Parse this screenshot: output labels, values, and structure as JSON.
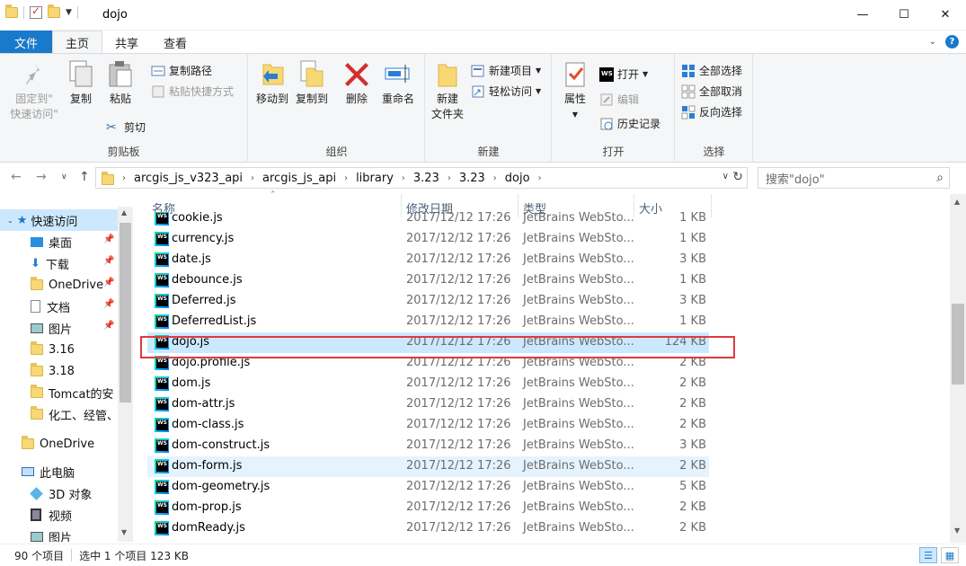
{
  "window": {
    "title": "dojo",
    "minimize": "—",
    "maximize": "☐",
    "close": "✕"
  },
  "tabs": {
    "file": "文件",
    "home": "主页",
    "share": "共享",
    "view": "查看"
  },
  "ribbon": {
    "clipboard": {
      "pin": "固定到\"",
      "pin2": "快速访问\"",
      "copy": "复制",
      "paste": "粘贴",
      "copy_path": "复制路径",
      "paste_shortcut": "粘贴快捷方式",
      "cut": "剪切",
      "label": "剪贴板"
    },
    "organize": {
      "move_to": "移动到",
      "copy_to": "复制到",
      "delete": "删除",
      "rename": "重命名",
      "label": "组织"
    },
    "new": {
      "new_folder_1": "新建",
      "new_folder_2": "文件夹",
      "new_item": "新建项目",
      "easy_access": "轻松访问",
      "label": "新建"
    },
    "open": {
      "properties": "属性",
      "open": "打开",
      "edit": "编辑",
      "history": "历史记录",
      "label": "打开"
    },
    "select": {
      "select_all": "全部选择",
      "select_none": "全部取消",
      "invert": "反向选择",
      "label": "选择"
    }
  },
  "address": {
    "crumbs": [
      "arcgis_js_v323_api",
      "arcgis_js_api",
      "library",
      "3.23",
      "3.23",
      "dojo"
    ],
    "search_placeholder": "搜索\"dojo\""
  },
  "nav": {
    "quick_access": "快速访问",
    "items": [
      "桌面",
      "下载",
      "OneDrive",
      "文档",
      "图片",
      "3.16",
      "3.18",
      "Tomcat的安",
      "化工、经管、"
    ],
    "onedrive": "OneDrive",
    "this_pc": "此电脑",
    "pc_items": [
      "3D 对象",
      "视频",
      "图片"
    ]
  },
  "columns": {
    "name": "名称",
    "date": "修改日期",
    "type": "类型",
    "size": "大小"
  },
  "files": [
    {
      "name": "cookie.js",
      "date": "2017/12/12 17:26",
      "type": "JetBrains WebSto...",
      "size": "1 KB"
    },
    {
      "name": "currency.js",
      "date": "2017/12/12 17:26",
      "type": "JetBrains WebSto...",
      "size": "1 KB"
    },
    {
      "name": "date.js",
      "date": "2017/12/12 17:26",
      "type": "JetBrains WebSto...",
      "size": "3 KB"
    },
    {
      "name": "debounce.js",
      "date": "2017/12/12 17:26",
      "type": "JetBrains WebSto...",
      "size": "1 KB"
    },
    {
      "name": "Deferred.js",
      "date": "2017/12/12 17:26",
      "type": "JetBrains WebSto...",
      "size": "3 KB"
    },
    {
      "name": "DeferredList.js",
      "date": "2017/12/12 17:26",
      "type": "JetBrains WebSto...",
      "size": "1 KB"
    },
    {
      "name": "dojo.js",
      "date": "2017/12/12 17:26",
      "type": "JetBrains WebSto...",
      "size": "124 KB"
    },
    {
      "name": "dojo.profile.js",
      "date": "2017/12/12 17:26",
      "type": "JetBrains WebSto...",
      "size": "2 KB"
    },
    {
      "name": "dom.js",
      "date": "2017/12/12 17:26",
      "type": "JetBrains WebSto...",
      "size": "2 KB"
    },
    {
      "name": "dom-attr.js",
      "date": "2017/12/12 17:26",
      "type": "JetBrains WebSto...",
      "size": "2 KB"
    },
    {
      "name": "dom-class.js",
      "date": "2017/12/12 17:26",
      "type": "JetBrains WebSto...",
      "size": "2 KB"
    },
    {
      "name": "dom-construct.js",
      "date": "2017/12/12 17:26",
      "type": "JetBrains WebSto...",
      "size": "3 KB"
    },
    {
      "name": "dom-form.js",
      "date": "2017/12/12 17:26",
      "type": "JetBrains WebSto...",
      "size": "2 KB"
    },
    {
      "name": "dom-geometry.js",
      "date": "2017/12/12 17:26",
      "type": "JetBrains WebSto...",
      "size": "5 KB"
    },
    {
      "name": "dom-prop.js",
      "date": "2017/12/12 17:26",
      "type": "JetBrains WebSto...",
      "size": "2 KB"
    },
    {
      "name": "domReady.js",
      "date": "2017/12/12 17:26",
      "type": "JetBrains WebSto...",
      "size": "2 KB"
    }
  ],
  "status": {
    "count": "90 个项目",
    "selected": "选中 1 个项目  123 KB"
  },
  "colors": {
    "accent": "#1979ca",
    "selection": "#cce8ff",
    "highlight_box": "#e0393e"
  }
}
